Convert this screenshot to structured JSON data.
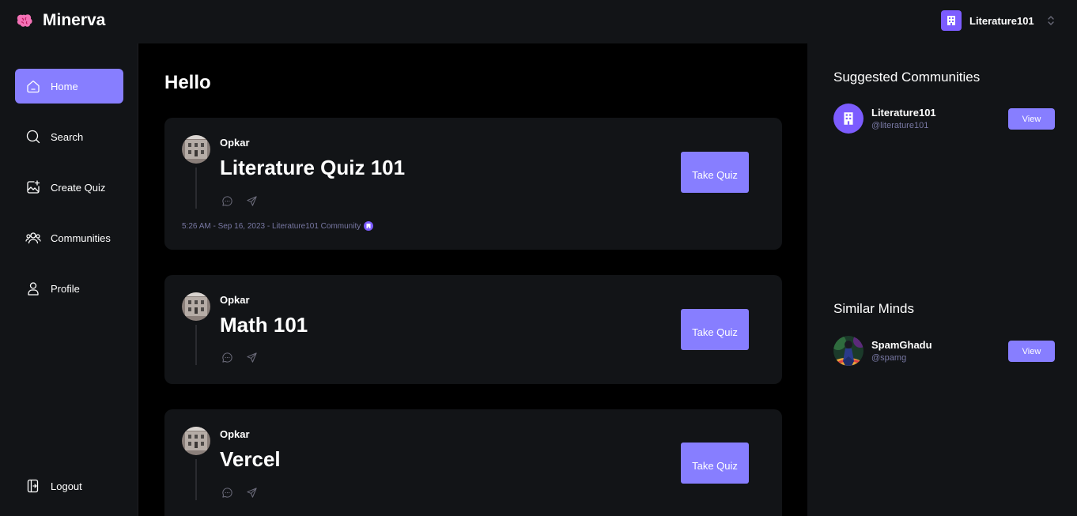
{
  "app": {
    "name": "Minerva"
  },
  "org_switcher": {
    "name": "Literature101"
  },
  "nav": {
    "items": [
      {
        "label": "Home",
        "icon": "home-icon",
        "active": true
      },
      {
        "label": "Search",
        "icon": "search-icon",
        "active": false
      },
      {
        "label": "Create Quiz",
        "icon": "image-plus-icon",
        "active": false
      },
      {
        "label": "Communities",
        "icon": "users-icon",
        "active": false
      },
      {
        "label": "Profile",
        "icon": "user-icon",
        "active": false
      }
    ],
    "logout_label": "Logout"
  },
  "main": {
    "title": "Hello",
    "posts": [
      {
        "author": "Opkar",
        "title": "Literature Quiz 101",
        "button_label": "Take Quiz",
        "meta": "5:26 AM - Sep 16, 2023 - Literature101 Community"
      },
      {
        "author": "Opkar",
        "title": "Math 101",
        "button_label": "Take Quiz"
      },
      {
        "author": "Opkar",
        "title": "Vercel",
        "button_label": "Take Quiz"
      }
    ]
  },
  "right": {
    "suggested_title": "Suggested Communities",
    "suggested": [
      {
        "name": "Literature101",
        "handle": "@literature101",
        "button_label": "View"
      }
    ],
    "similar_title": "Similar Minds",
    "similar": [
      {
        "name": "SpamGhadu",
        "handle": "@spamg",
        "button_label": "View"
      }
    ]
  },
  "colors": {
    "accent": "#877eff",
    "background": "#000000",
    "panel": "#121417",
    "muted_text": "#7878a3",
    "brand": "#7c5cff"
  }
}
